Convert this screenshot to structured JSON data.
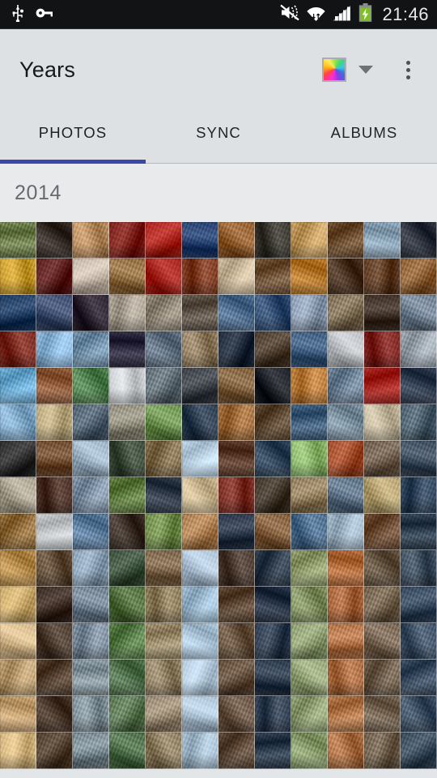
{
  "statusbar": {
    "time": "21:46",
    "left_icons": [
      "usb-icon",
      "vpn-key-icon"
    ],
    "right_icons": [
      "volume-mute-icon",
      "wifi-icon",
      "cellular-signal-icon",
      "battery-charging-icon"
    ],
    "background": "#111314",
    "text_color": "#e9eaea"
  },
  "appbar": {
    "title": "Years",
    "color_swatch_name": "color-filter-swatch",
    "dropdown_name": "dropdown-arrow-icon",
    "overflow_name": "overflow-menu-icon",
    "background": "#dde1e4"
  },
  "tabs": {
    "active_index": 0,
    "indicator_color": "#3b48a8",
    "items": [
      {
        "label": "PHOTOS",
        "active": true
      },
      {
        "label": "SYNC",
        "active": false
      },
      {
        "label": "ALBUMS",
        "active": false
      }
    ]
  },
  "section": {
    "year_label": "2014",
    "background": "#e8eaec",
    "label_color": "#656b70"
  },
  "grid": {
    "columns": 12,
    "cell_size_px": 45,
    "first_row_clipped": true,
    "thumbnails": [
      "#6b7c4a",
      "#352b26",
      "#b58a5e",
      "#7b1f18",
      "#a8231c",
      "#25406e",
      "#8e5b2d",
      "#3a3730",
      "#c19a5e",
      "#6a4b2e",
      "#8aa3b6",
      "#2a2f3a",
      "#c79a2e",
      "#5a1d1c",
      "#c4b6a8",
      "#8d6a3f",
      "#a4231d",
      "#7c3a22",
      "#c9b79a",
      "#6e5136",
      "#b5762a",
      "#47301f",
      "#5d3b23",
      "#8a5d33",
      "#1e3a5f",
      "#3b4a6b",
      "#2b2230",
      "#a9a092",
      "#8f8576",
      "#5e5348",
      "#4b6a8c",
      "#2f4a6e",
      "#8b9bb0",
      "#7a6a52",
      "#3d2f26",
      "#6d7d8e",
      "#7a2a20",
      "#8ab4d8",
      "#6f8ea8",
      "#2e2a3f",
      "#5f6f80",
      "#8e7a5e",
      "#1f2a3a",
      "#4a3a2c",
      "#3c5a7c",
      "#b9bcc0",
      "#7d2420",
      "#9aa4ad",
      "#69a8d0",
      "#8e5a3a",
      "#4f7e4e",
      "#c9cdd0",
      "#5d6a72",
      "#3a3f46",
      "#7b5c3b",
      "#1c1f25",
      "#b87a3a",
      "#6a7f93",
      "#a3231e",
      "#2d3a4d",
      "#7fa8c8",
      "#b9a77e",
      "#4e5e6e",
      "#8e8a7a",
      "#6a8f4e",
      "#2b3c4e",
      "#9e6a3a",
      "#5a4630",
      "#3e5c7a",
      "#7a8f9e",
      "#c0b49a",
      "#4a5d6b",
      "#2b2b2b",
      "#6e4a2e",
      "#9ab0c2",
      "#3c4a3a",
      "#7e6a4a",
      "#b8d0e2",
      "#5a3a2a",
      "#2e4258",
      "#8ab46a",
      "#9e4a2a",
      "#6b5a4a",
      "#3a4a5a",
      "#a8a08e",
      "#4a3026",
      "#7e90a4",
      "#5e7a3e",
      "#2f3a48",
      "#c8b48e",
      "#7a2e24",
      "#3e3428",
      "#8e7a5a",
      "#5a6e82",
      "#b4a070",
      "#30445a",
      "#8e6a3a",
      "#c2c6c9",
      "#5a7a9a",
      "#3a2e26",
      "#6e8a4a",
      "#a87a4e",
      "#2a3648",
      "#7e5a3a",
      "#4a6a8a",
      "#9eb4c4",
      "#6a4a32",
      "#2e3e4e",
      "#b48a4a",
      "#5e4a36",
      "#8aa0b4",
      "#3a4e3a",
      "#7a6248",
      "#aabfd2",
      "#4a3a30",
      "#2c3a4a",
      "#8e9a6a",
      "#b06a3a",
      "#60503e",
      "#3c4c5c",
      "#c8a86a",
      "#3a2a22",
      "#6e7e8e",
      "#4e6a3a",
      "#8a7a5a",
      "#9ab8ce",
      "#5a4432",
      "#263244",
      "#7e8e5e",
      "#a4623a",
      "#6e5e4a",
      "#34465a",
      "#d0b488",
      "#4a3a2e",
      "#7a8a9a",
      "#567a46",
      "#9a8a6a",
      "#a8c2d6",
      "#64503c",
      "#2e3c4e",
      "#8a9a6e",
      "#ae7046",
      "#746250",
      "#3e5064",
      "#b89a6e",
      "#523e2e",
      "#86969e",
      "#4e6e4a",
      "#8e7e62",
      "#b2c8da",
      "#5e4a38",
      "#2a384a",
      "#92a276",
      "#a86a40",
      "#6a5a48",
      "#384a5e",
      "#c4a070",
      "#463428",
      "#7e8e96",
      "#56724e",
      "#968670",
      "#aac0d2",
      "#665242",
      "#303e50",
      "#8e9e72",
      "#b07448",
      "#70604e",
      "#3a4c60",
      "#d2b47e",
      "#4e3c2c",
      "#76868e",
      "#4a6a46",
      "#8a7a5e",
      "#a2bacc",
      "#5a4636",
      "#2c3a4c",
      "#869a6a",
      "#a86c42",
      "#6c5c4a",
      "#364858"
    ]
  }
}
